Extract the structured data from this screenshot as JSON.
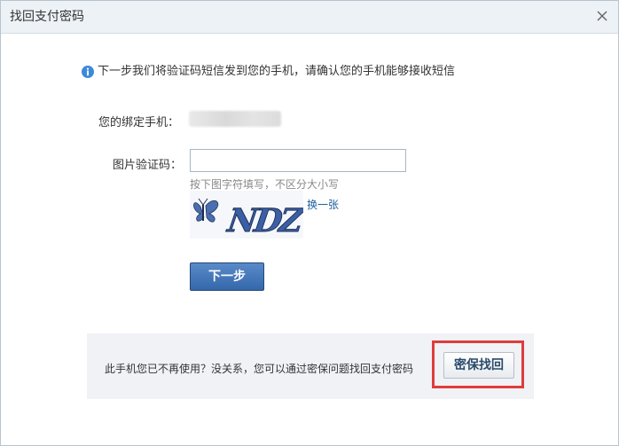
{
  "dialog": {
    "title": "找回支付密码"
  },
  "info": {
    "message": "下一步我们将验证码短信发到您的手机，请确认您的手机能够接收短信"
  },
  "form": {
    "phone_label": "您的绑定手机：",
    "captcha_label": "图片验证码：",
    "captcha_value": "",
    "captcha_hint": "按下图字符填写，不区分大小写",
    "captcha_text": "NDZ",
    "refresh_label": "换一张",
    "next_label": "下一步"
  },
  "alternative": {
    "message": "此手机您已不再使用？没关系，您可以通过密保问题找回支付密码",
    "button_label": "密保找回"
  },
  "colors": {
    "primary_button": "#3468ab",
    "highlight": "#e03c3c",
    "link": "#1a5f9e"
  },
  "icons": {
    "close": "close-icon",
    "info": "info-icon"
  }
}
